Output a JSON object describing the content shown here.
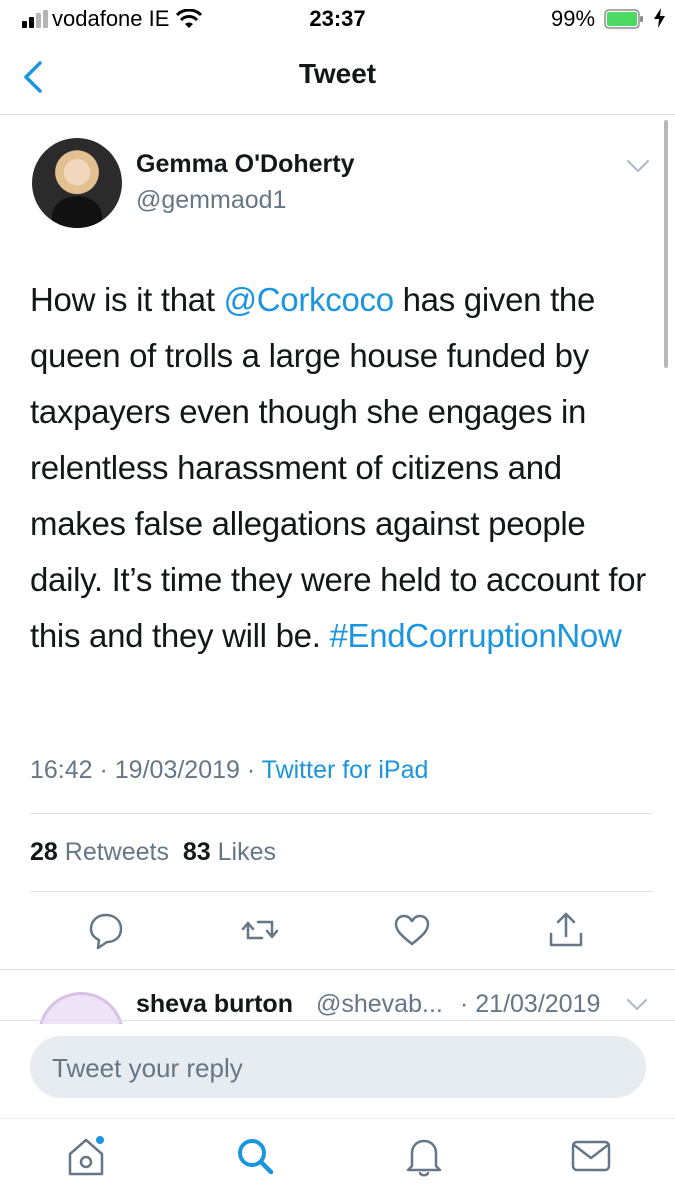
{
  "status_bar": {
    "carrier": "vodafone IE",
    "time": "23:37",
    "battery_percent": "99%"
  },
  "nav": {
    "title": "Tweet",
    "back_icon": "chevron-left-icon"
  },
  "tweet": {
    "author_name": "Gemma O'Doherty",
    "author_handle": "@gemmaod1",
    "text_before_mention": "How is it that ",
    "mention": "@Corkcoco",
    "text_after_mention": " has given the queen of trolls a large house funded by taxpayers even though she engages in relentless harassment of citizens and makes false allegations against people daily. It’s time they were held to account for this and they will be. ",
    "hashtag": "#EndCorruptionNow",
    "time": "16:42",
    "date": "19/03/2019",
    "source": "Twitter for iPad",
    "retweets_count": "28",
    "retweets_label": "Retweets",
    "likes_count": "83",
    "likes_label": "Likes"
  },
  "reply": {
    "author_name": "sheva burton",
    "author_handle": "@shevab...",
    "date": "· 21/03/2019"
  },
  "composer": {
    "placeholder": "Tweet your reply"
  },
  "colors": {
    "accent": "#1b95e0",
    "battery": "#4cd964",
    "secondary_text": "#657786"
  },
  "tab_bar": {
    "items": [
      "home-icon",
      "search-icon",
      "notifications-icon",
      "messages-icon"
    ]
  }
}
